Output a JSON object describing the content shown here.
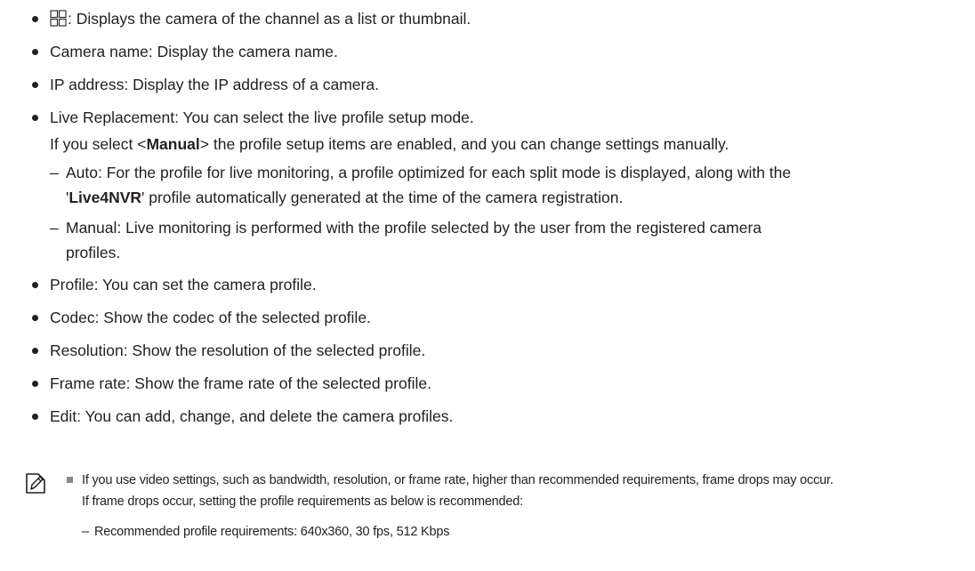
{
  "bullets": {
    "view_toggle": ": Displays the camera of the channel as a list or thumbnail.",
    "camera_name": "Camera name: Display the camera name.",
    "ip_address": "IP address: Display the IP address of a camera.",
    "live_replacement": {
      "line1": "Live Replacement: You can select the live profile setup mode.",
      "line2_pre": "If you select <",
      "line2_bold": "Manual",
      "line2_post": "> the profile setup items are enabled, and you can change settings manually.",
      "auto_line1": "Auto: For the profile for live monitoring, a profile optimized for each split mode is displayed, along with the",
      "auto_line2_pre": "'",
      "auto_line2_bold": "Live4NVR",
      "auto_line2_post": "' profile automatically generated at the time of the camera registration.",
      "manual_line1": "Manual: Live monitoring is performed with the profile selected by the user from the registered camera",
      "manual_line2": "profiles."
    },
    "profile": "Profile: You can set the camera profile.",
    "codec": "Codec: Show the codec of the selected profile.",
    "resolution": "Resolution: Show the resolution of the selected profile.",
    "frame_rate": "Frame rate: Show the frame rate of the selected profile.",
    "edit": "Edit: You can add, change, and delete the camera profiles."
  },
  "note": {
    "line1": "If you use video settings, such as bandwidth, resolution, or frame rate, higher than recommended requirements, frame drops may occur.",
    "line2": "If frame drops occur, setting the profile requirements as below is recommended:",
    "recommended": "Recommended profile requirements: 640x360, 30 fps, 512 Kbps"
  },
  "icons": {
    "view_toggle": "grid-view-icon",
    "note": "note-pencil-icon"
  }
}
